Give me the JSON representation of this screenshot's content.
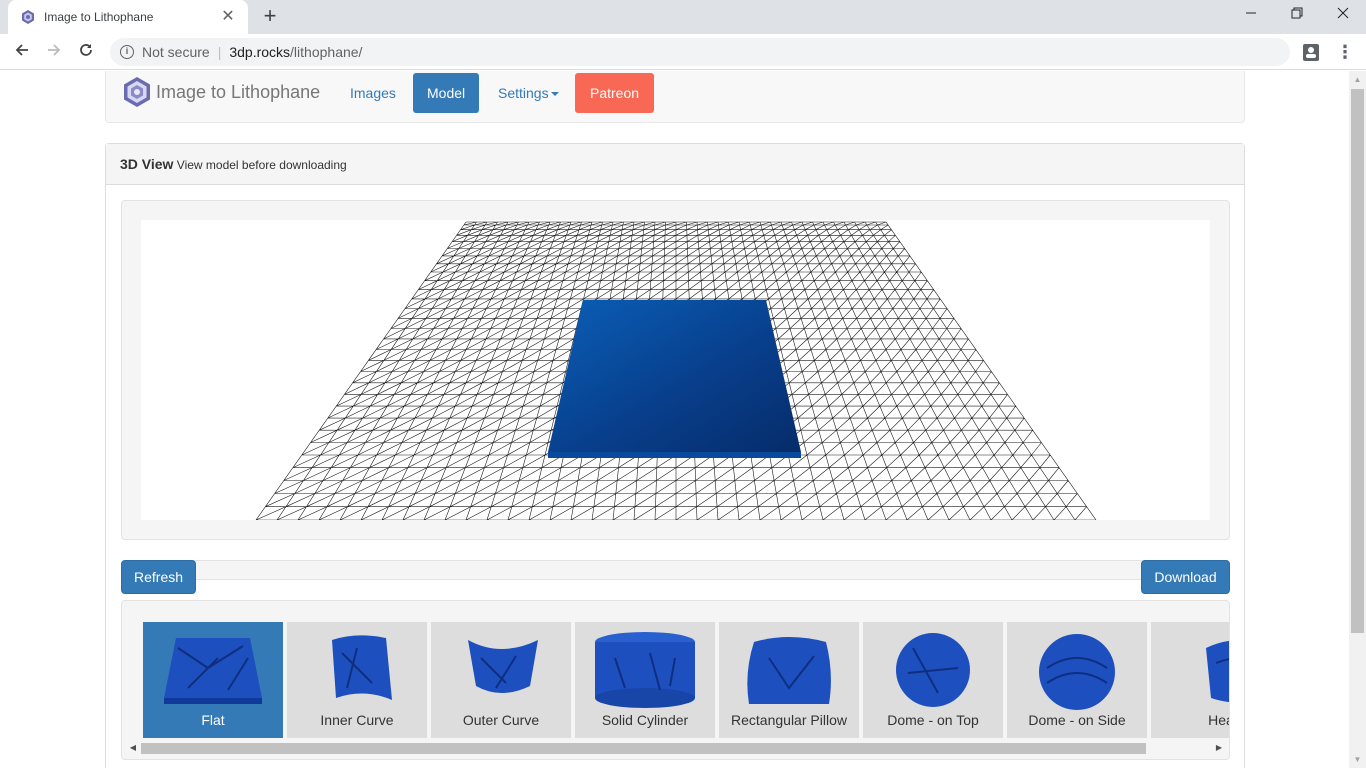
{
  "browser": {
    "tab_title": "Image to Lithophane",
    "tab_close": "✕",
    "new_tab": "+",
    "security_label": "Not secure",
    "url_host": "3dp.rocks",
    "url_path": "/lithophane/",
    "menu_dots": "⋮"
  },
  "navbar": {
    "brand": "Image to Lithophane",
    "items": [
      "Images",
      "Model",
      "Settings",
      "Patreon"
    ],
    "active_item": "Model",
    "accent_color": "#337ab7",
    "patreon_color": "#f96854"
  },
  "panel": {
    "title": "3D View",
    "subtitle": "View model before downloading"
  },
  "toolbar": {
    "refresh_label": "Refresh",
    "download_label": "Download"
  },
  "shapes": {
    "items": [
      "Flat",
      "Inner Curve",
      "Outer Curve",
      "Solid Cylinder",
      "Rectangular Pillow",
      "Dome - on Top",
      "Dome - on Side",
      "Hea"
    ],
    "selected": "Flat"
  },
  "model_color": "#0b3e8a"
}
